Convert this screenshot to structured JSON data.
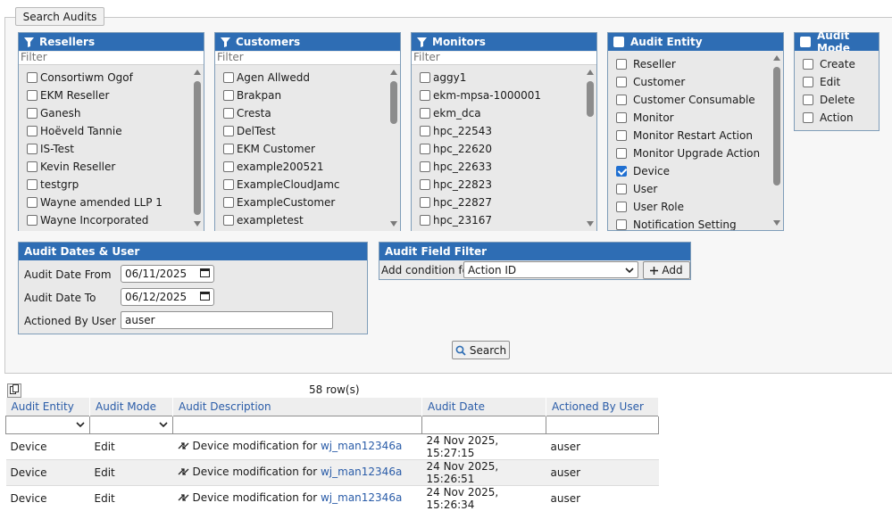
{
  "search_audits_label": "Search Audits",
  "resellers": {
    "title": "Resellers",
    "filter_placeholder": "Filter",
    "items": [
      "Consortiwm Ogof",
      "EKM Reseller",
      "Ganesh",
      "Hoëveld Tannie",
      "IS-Test",
      "Kevin Reseller",
      "testgrp",
      "Wayne amended LLP 1",
      "Wayne Incorporated"
    ]
  },
  "customers": {
    "title": "Customers",
    "filter_placeholder": "Filter",
    "items": [
      "Agen Allwedd",
      "Brakpan",
      "Cresta",
      "DelTest",
      "EKM Customer",
      "example200521",
      "ExampleCloudJamc",
      "ExampleCustomer",
      "exampletest"
    ]
  },
  "monitors": {
    "title": "Monitors",
    "filter_placeholder": "Filter",
    "items": [
      "aggy1",
      "ekm-mpsa-1000001",
      "ekm_dca",
      "hpc_22543",
      "hpc_22620",
      "hpc_22633",
      "hpc_22823",
      "hpc_22827",
      "hpc_23167"
    ]
  },
  "audit_entity": {
    "title": "Audit Entity",
    "items": [
      {
        "label": "Reseller",
        "checked": false
      },
      {
        "label": "Customer",
        "checked": false
      },
      {
        "label": "Customer Consumable",
        "checked": false
      },
      {
        "label": "Monitor",
        "checked": false
      },
      {
        "label": "Monitor Restart Action",
        "checked": false
      },
      {
        "label": "Monitor Upgrade Action",
        "checked": false
      },
      {
        "label": "Device",
        "checked": true
      },
      {
        "label": "User",
        "checked": false
      },
      {
        "label": "User Role",
        "checked": false
      },
      {
        "label": "Notification Setting",
        "checked": false
      }
    ]
  },
  "audit_mode": {
    "title": "Audit Mode",
    "items": [
      "Create",
      "Edit",
      "Delete",
      "Action"
    ]
  },
  "dates_user": {
    "title": "Audit Dates & User",
    "date_from_label": "Audit Date From",
    "date_from_value": "06/11/2025",
    "date_to_label": "Audit Date To",
    "date_to_value": "06/12/2025",
    "user_label": "Actioned By User",
    "user_value": "auser"
  },
  "field_filter": {
    "title": "Audit Field Filter",
    "add_condition_label": "Add condition for",
    "selected_field": "Action ID",
    "add_button": "Add"
  },
  "search_button": "Search",
  "results": {
    "row_count": "58 row(s)",
    "columns": [
      "Audit Entity",
      "Audit Mode",
      "Audit Description",
      "Audit Date",
      "Actioned By User"
    ],
    "rows": [
      {
        "entity": "Device",
        "mode": "Edit",
        "description": "Device modification for",
        "link": "wj_man12346a",
        "date": "24 Nov 2025, 15:27:15",
        "user": "auser"
      },
      {
        "entity": "Device",
        "mode": "Edit",
        "description": "Device modification for",
        "link": "wj_man12346a",
        "date": "24 Nov 2025, 15:26:51",
        "user": "auser"
      },
      {
        "entity": "Device",
        "mode": "Edit",
        "description": "Device modification for",
        "link": "wj_man12346a",
        "date": "24 Nov 2025, 15:26:34",
        "user": "auser"
      }
    ]
  },
  "colors": {
    "panel_header": "#2e6db4",
    "link": "#2a5ca8",
    "checked": "#1f6fd1"
  }
}
